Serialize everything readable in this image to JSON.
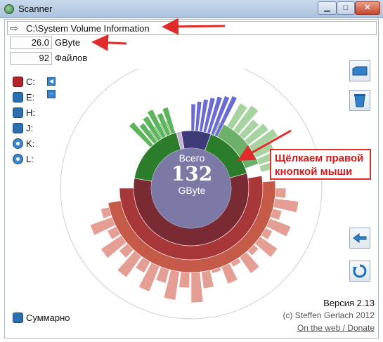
{
  "window": {
    "title": "Scanner"
  },
  "path": {
    "value": "C:\\System Volume Information"
  },
  "stats": {
    "size_value": "26.0",
    "size_unit": "GByte",
    "files_value": "92",
    "files_label": "Файлов"
  },
  "drives": [
    {
      "label": "C:",
      "icon": "hard-drive-red"
    },
    {
      "label": "E:",
      "icon": "hard-drive"
    },
    {
      "label": "H:",
      "icon": "hard-drive"
    },
    {
      "label": "J:",
      "icon": "hard-drive"
    },
    {
      "label": "K:",
      "icon": "disc"
    },
    {
      "label": "L:",
      "icon": "disc"
    }
  ],
  "center": {
    "caption": "Всего",
    "total": "132",
    "unit": "GByte"
  },
  "annotation": {
    "line1": "Щёлкаем правой",
    "line2": "кнопкой мыши"
  },
  "footer": {
    "version": "Версия 2.13",
    "copyright": "(c) Steffen Gerlach 2012",
    "link": "On the web / Donate",
    "summary_label": "Суммарно"
  },
  "colors": {
    "arrow": "#e12a2a",
    "center": "#7c79a6",
    "green": "#2e8a2e",
    "red": "#c84040"
  }
}
